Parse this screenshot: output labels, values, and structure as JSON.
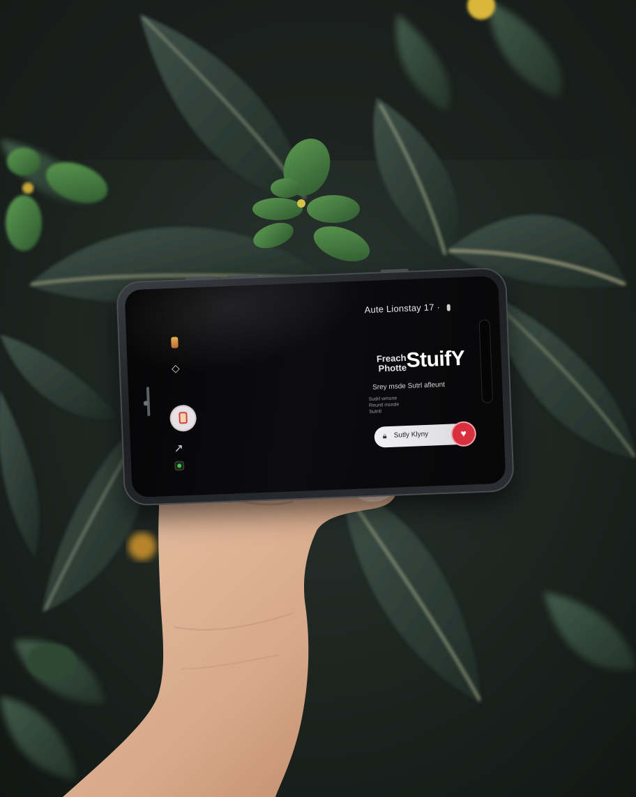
{
  "status_bar": {
    "text": "Aute Lionstay 17 ·"
  },
  "app": {
    "hero_small": "Freach Photte",
    "brand": "StuifY",
    "tagline": "Srey msde Sutrl afleunt",
    "details": [
      "Sudrl wmsne",
      "Reuntl msnde",
      "Sutnll"
    ],
    "cta_label": "Sutly Klyny",
    "cta_icon": "heart-icon"
  },
  "colors": {
    "accent_red": "#d9303e",
    "screen_bg": "#07070a",
    "frame": "#2b2e33"
  }
}
